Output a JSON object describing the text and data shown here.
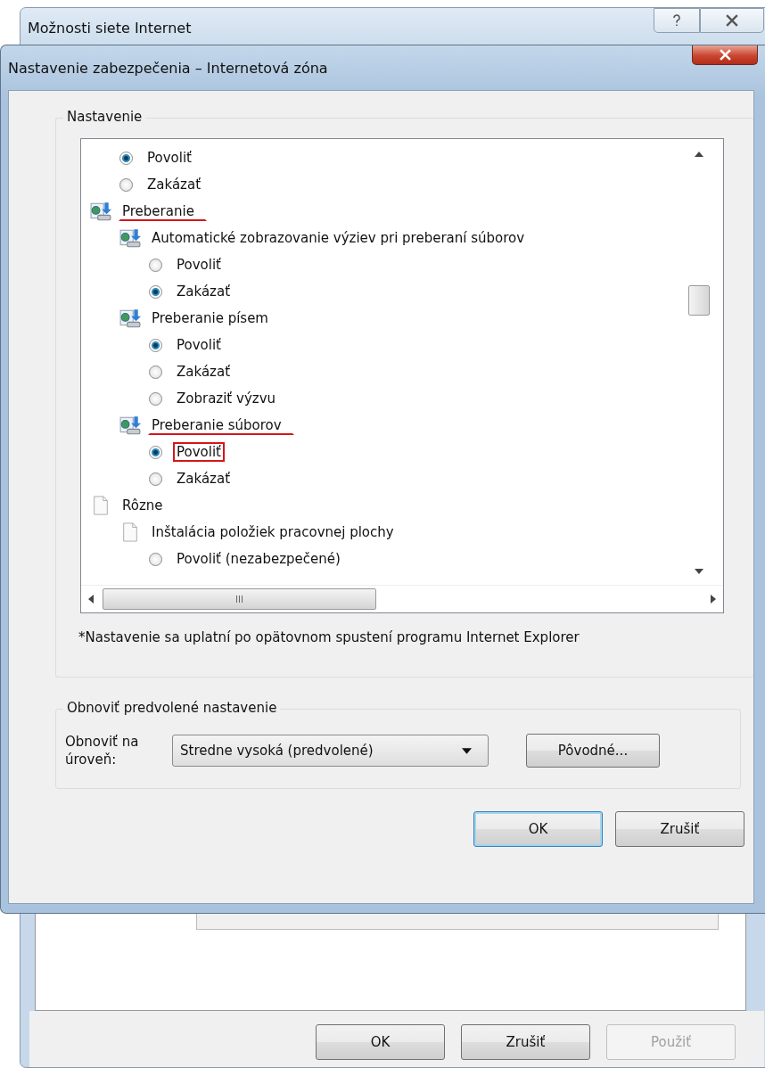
{
  "outer_window": {
    "title": "Možnosti siete Internet",
    "buttons": [
      {
        "label": "OK",
        "disabled": false
      },
      {
        "label": "Zrušiť",
        "disabled": false
      },
      {
        "label": "Použiť",
        "disabled": true
      }
    ]
  },
  "dialog": {
    "title": "Nastavenie zabezpečenia – Internetová zóna",
    "settings": {
      "legend": "Nastavenie",
      "continued_options": [
        {
          "kind": "option",
          "label": "Povoliť",
          "selected": true,
          "marked": false
        },
        {
          "kind": "option",
          "label": "Zakázať",
          "selected": false,
          "marked": false
        }
      ],
      "nodes": [
        {
          "kind": "setting",
          "label": "Preberanie",
          "marked": true,
          "children": [
            {
              "kind": "setting",
              "label": "Automatické zobrazovanie výziev pri preberaní súborov",
              "marked": false,
              "children": [
                {
                  "kind": "option",
                  "label": "Povoliť",
                  "selected": false,
                  "marked": false
                },
                {
                  "kind": "option",
                  "label": "Zakázať",
                  "selected": true,
                  "marked": false
                }
              ]
            },
            {
              "kind": "setting",
              "label": "Preberanie písem",
              "marked": false,
              "children": [
                {
                  "kind": "option",
                  "label": "Povoliť",
                  "selected": true,
                  "marked": false
                },
                {
                  "kind": "option",
                  "label": "Zakázať",
                  "selected": false,
                  "marked": false
                },
                {
                  "kind": "option",
                  "label": "Zobraziť výzvu",
                  "selected": false,
                  "marked": false
                }
              ]
            },
            {
              "kind": "setting",
              "label": "Preberanie súborov",
              "marked": true,
              "children": [
                {
                  "kind": "option",
                  "label": "Povoliť",
                  "selected": true,
                  "marked": true
                },
                {
                  "kind": "option",
                  "label": "Zakázať",
                  "selected": false,
                  "marked": false
                }
              ]
            }
          ]
        },
        {
          "kind": "category",
          "label": "Rôzne",
          "marked": false,
          "children": [
            {
              "kind": "category",
              "label": "Inštalácia položiek pracovnej plochy",
              "marked": false,
              "children": [
                {
                  "kind": "option",
                  "label": "Povoliť (nezabezpečené)",
                  "selected": false,
                  "marked": false
                }
              ]
            }
          ]
        }
      ]
    },
    "note": "*Nastavenie sa uplatní po opätovnom spustení programu Internet Explorer",
    "reset": {
      "legend": "Obnoviť predvolené nastavenie",
      "label": "Obnoviť na úroveň:",
      "level_value": "Stredne vysoká (predvolené)",
      "reset_button": "Pôvodné..."
    },
    "buttons": [
      {
        "label": "OK",
        "default": true
      },
      {
        "label": "Zrušiť",
        "default": false
      }
    ]
  }
}
